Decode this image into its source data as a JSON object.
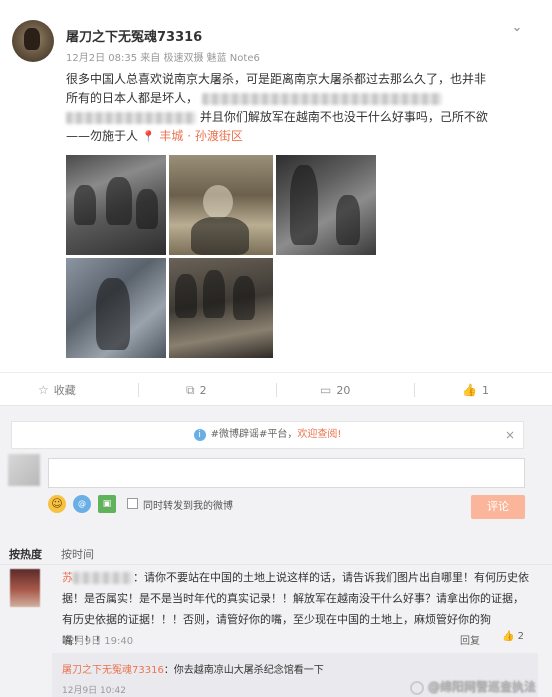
{
  "post": {
    "username": "屠刀之下无冤魂73316",
    "meta": "12月2日 08:35 来自 极速双摄 魅蓝 Note6",
    "line1": "很多中国人总喜欢说南京大屠杀，可是距离南京大屠杀都过去那么久了，也并非",
    "line2": "所有的日本人都是坏人，",
    "line3": "并且你们解放军在越南不也没干什么好事吗，己所不欲",
    "line4": "——勿施于人",
    "location": "丰城 · 孙渡街区"
  },
  "actions": {
    "favorite": "收藏",
    "repost_count": "2",
    "comment_count": "20",
    "like_count": "1"
  },
  "notice": {
    "text": "#微博辟谣#平台，",
    "link": "欢迎查阅!"
  },
  "composer": {
    "sync_label": "同时转发到我的微博",
    "submit_label": "评论"
  },
  "sort": {
    "hot": "按热度",
    "time": "按时间"
  },
  "comment": {
    "nick": "苏",
    "text": "：请你不要站在中国的土地上说这样的话，请告诉我们图片出自哪里！有何历史依据！是否属实！是不是当时年代的真实记录！！解放军在越南没干什么好事？请拿出你的证据，有历史依据的证据！！！否则，请管好你的嘴，至少现在中国的土地上，麻烦管好你的狗嘴！！！",
    "time": "12月9日 19:40",
    "reply_label": "回复",
    "like_count": "2"
  },
  "reply": {
    "nick": "屠刀之下无冤魂73316",
    "text": "：你去越南凉山大屠杀纪念馆看一下",
    "time": "12月9日 10:42"
  },
  "watermark": "@绵阳网警巡查执法"
}
